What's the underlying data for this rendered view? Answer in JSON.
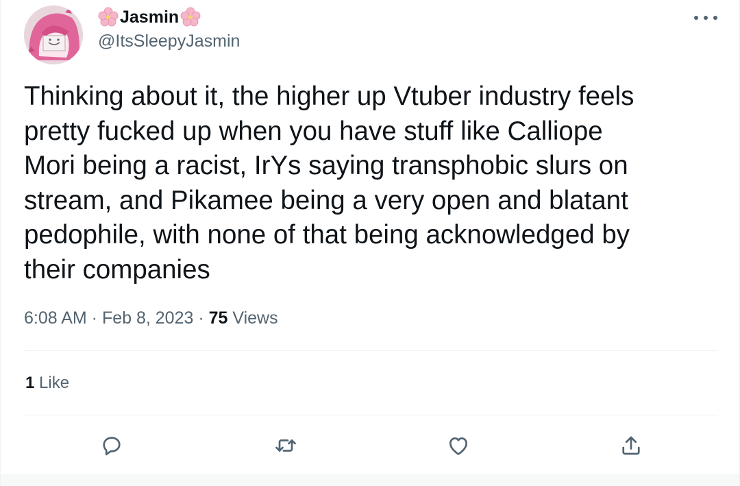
{
  "author": {
    "display_name": "Jasmin",
    "handle": "@ItsSleepyJasmin",
    "avatar_icon": "anime-avatar-icon",
    "name_decoration_icon": "cherry-blossom-icon"
  },
  "tweet": {
    "text": "Thinking about it, the higher up Vtuber industry feels\npretty fucked up when you have stuff like Calliope\nMori being a racist, IrYs saying transphobic slurs on\nstream, and Pikamee being a very open and blatant\npedophile, with none of that being acknowledged by\ntheir companies",
    "time": "6:08 AM",
    "separator": " · ",
    "date": "Feb 8, 2023",
    "views_count": "75",
    "views_label": " Views"
  },
  "stats": {
    "likes_count": "1",
    "likes_label": " Like"
  },
  "actions": [
    {
      "name": "reply",
      "icon": "reply-icon"
    },
    {
      "name": "retweet",
      "icon": "retweet-icon"
    },
    {
      "name": "like",
      "icon": "heart-icon"
    },
    {
      "name": "share",
      "icon": "share-icon"
    }
  ],
  "colors": {
    "text_primary": "#0f1419",
    "text_secondary": "#536471",
    "divider": "#eff3f4",
    "flower": "#f4b6c8"
  }
}
